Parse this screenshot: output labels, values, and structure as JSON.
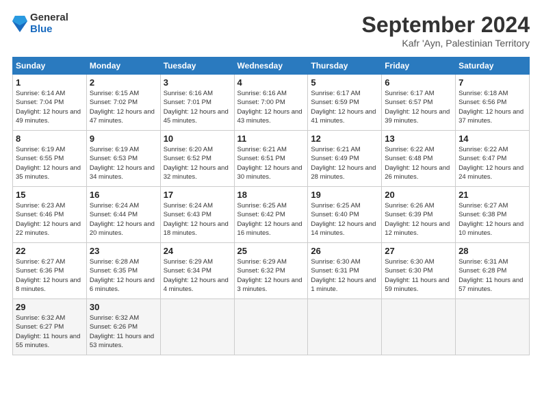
{
  "header": {
    "logo": {
      "general": "General",
      "blue": "Blue"
    },
    "title": "September 2024",
    "location": "Kafr 'Ayn, Palestinian Territory"
  },
  "weekdays": [
    "Sunday",
    "Monday",
    "Tuesday",
    "Wednesday",
    "Thursday",
    "Friday",
    "Saturday"
  ],
  "weeks": [
    [
      {
        "day": "1",
        "sunrise": "6:14 AM",
        "sunset": "7:04 PM",
        "daylight": "12 hours and 49 minutes."
      },
      {
        "day": "2",
        "sunrise": "6:15 AM",
        "sunset": "7:02 PM",
        "daylight": "12 hours and 47 minutes."
      },
      {
        "day": "3",
        "sunrise": "6:16 AM",
        "sunset": "7:01 PM",
        "daylight": "12 hours and 45 minutes."
      },
      {
        "day": "4",
        "sunrise": "6:16 AM",
        "sunset": "7:00 PM",
        "daylight": "12 hours and 43 minutes."
      },
      {
        "day": "5",
        "sunrise": "6:17 AM",
        "sunset": "6:59 PM",
        "daylight": "12 hours and 41 minutes."
      },
      {
        "day": "6",
        "sunrise": "6:17 AM",
        "sunset": "6:57 PM",
        "daylight": "12 hours and 39 minutes."
      },
      {
        "day": "7",
        "sunrise": "6:18 AM",
        "sunset": "6:56 PM",
        "daylight": "12 hours and 37 minutes."
      }
    ],
    [
      {
        "day": "8",
        "sunrise": "6:19 AM",
        "sunset": "6:55 PM",
        "daylight": "12 hours and 35 minutes."
      },
      {
        "day": "9",
        "sunrise": "6:19 AM",
        "sunset": "6:53 PM",
        "daylight": "12 hours and 34 minutes."
      },
      {
        "day": "10",
        "sunrise": "6:20 AM",
        "sunset": "6:52 PM",
        "daylight": "12 hours and 32 minutes."
      },
      {
        "day": "11",
        "sunrise": "6:21 AM",
        "sunset": "6:51 PM",
        "daylight": "12 hours and 30 minutes."
      },
      {
        "day": "12",
        "sunrise": "6:21 AM",
        "sunset": "6:49 PM",
        "daylight": "12 hours and 28 minutes."
      },
      {
        "day": "13",
        "sunrise": "6:22 AM",
        "sunset": "6:48 PM",
        "daylight": "12 hours and 26 minutes."
      },
      {
        "day": "14",
        "sunrise": "6:22 AM",
        "sunset": "6:47 PM",
        "daylight": "12 hours and 24 minutes."
      }
    ],
    [
      {
        "day": "15",
        "sunrise": "6:23 AM",
        "sunset": "6:46 PM",
        "daylight": "12 hours and 22 minutes."
      },
      {
        "day": "16",
        "sunrise": "6:24 AM",
        "sunset": "6:44 PM",
        "daylight": "12 hours and 20 minutes."
      },
      {
        "day": "17",
        "sunrise": "6:24 AM",
        "sunset": "6:43 PM",
        "daylight": "12 hours and 18 minutes."
      },
      {
        "day": "18",
        "sunrise": "6:25 AM",
        "sunset": "6:42 PM",
        "daylight": "12 hours and 16 minutes."
      },
      {
        "day": "19",
        "sunrise": "6:25 AM",
        "sunset": "6:40 PM",
        "daylight": "12 hours and 14 minutes."
      },
      {
        "day": "20",
        "sunrise": "6:26 AM",
        "sunset": "6:39 PM",
        "daylight": "12 hours and 12 minutes."
      },
      {
        "day": "21",
        "sunrise": "6:27 AM",
        "sunset": "6:38 PM",
        "daylight": "12 hours and 10 minutes."
      }
    ],
    [
      {
        "day": "22",
        "sunrise": "6:27 AM",
        "sunset": "6:36 PM",
        "daylight": "12 hours and 8 minutes."
      },
      {
        "day": "23",
        "sunrise": "6:28 AM",
        "sunset": "6:35 PM",
        "daylight": "12 hours and 6 minutes."
      },
      {
        "day": "24",
        "sunrise": "6:29 AM",
        "sunset": "6:34 PM",
        "daylight": "12 hours and 4 minutes."
      },
      {
        "day": "25",
        "sunrise": "6:29 AM",
        "sunset": "6:32 PM",
        "daylight": "12 hours and 3 minutes."
      },
      {
        "day": "26",
        "sunrise": "6:30 AM",
        "sunset": "6:31 PM",
        "daylight": "12 hours and 1 minute."
      },
      {
        "day": "27",
        "sunrise": "6:30 AM",
        "sunset": "6:30 PM",
        "daylight": "11 hours and 59 minutes."
      },
      {
        "day": "28",
        "sunrise": "6:31 AM",
        "sunset": "6:28 PM",
        "daylight": "11 hours and 57 minutes."
      }
    ],
    [
      {
        "day": "29",
        "sunrise": "6:32 AM",
        "sunset": "6:27 PM",
        "daylight": "11 hours and 55 minutes."
      },
      {
        "day": "30",
        "sunrise": "6:32 AM",
        "sunset": "6:26 PM",
        "daylight": "11 hours and 53 minutes."
      },
      null,
      null,
      null,
      null,
      null
    ]
  ]
}
